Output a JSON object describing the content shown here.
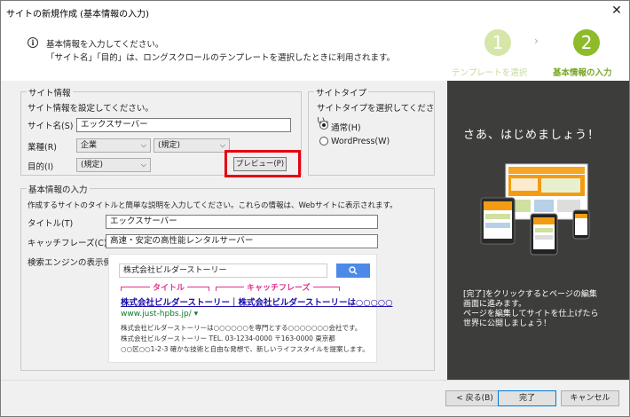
{
  "window": {
    "title": "サイトの新規作成 (基本情報の入力)",
    "close": "✕"
  },
  "header": {
    "info_line1": "基本情報を入力してください。",
    "info_line2": "「サイト名」「目的」は、ロングスクロールのテンプレートを選択したときに利用されます。",
    "steps": [
      {
        "number": "1",
        "label": "テンプレートを選択"
      },
      {
        "number": "2",
        "label": "基本情報の入力"
      }
    ],
    "arrow": "›"
  },
  "site_info": {
    "legend": "サイト情報",
    "desc": "サイト情報を設定してください。",
    "name_label": "サイト名(S)",
    "name_value": "エックスサーバー",
    "industry_label": "業種(R)",
    "industry_value": "企業",
    "industry_sub_value": "(規定)",
    "purpose_label": "目的(I)",
    "purpose_value": "(規定)",
    "preview_button": "プレビュー(P)"
  },
  "site_type": {
    "legend": "サイトタイプ",
    "desc": "サイトタイプを選択してください。",
    "option_normal": "通常(H)",
    "option_wordpress": "WordPress(W)",
    "selected": "通常(H)"
  },
  "basic_info": {
    "legend": "基本情報の入力",
    "desc": "作成するサイトのタイトルと簡単な説明を入力してください。これらの情報は、Webサイトに表示されます。",
    "title_label": "タイトル(T)",
    "title_value": "エックスサーバー",
    "catch_label": "キャッチフレーズ(C)",
    "catch_value": "高速・安定の高性能レンタルサーバー",
    "search_label": "検索エンジンの表示例:"
  },
  "search_preview": {
    "query": "株式会社ビルダーストーリー",
    "search_icon": "search-icon",
    "tag_title": "タイトル",
    "tag_catch": "キャッチフレーズ",
    "result_title": "株式会社ビルダーストーリー｜株式会社ビルダーストーリーは○○○○○",
    "result_url": "www.just-hpbs.jp/ ▾",
    "desc_line1": "株式会社ビルダーストーリーは○○○○○○を専門とする○○○○○○○会社です。",
    "desc_line2": "株式会社ビルダーストーリー TEL. 03-1234-0000 〒163-0000 東京都",
    "desc_line3": "○○区○○1-2-3 確かな技術と自由な発想で、新しいライフスタイルを提案します。"
  },
  "right_panel": {
    "heading": "さあ、はじめましょう！",
    "text_line1": "[完了]をクリックするとページの編集",
    "text_line2": "画面に進みます。",
    "text_line3": "ページを編集してサイトを仕上げたら",
    "text_line4": "世界に公開しましょう！"
  },
  "footer": {
    "back": "< 戻る(B)",
    "finish": "完了",
    "cancel": "キャンセル"
  },
  "colors": {
    "accent_green": "#8dbb2a",
    "light_green": "#d6e6a8",
    "highlight_red": "#e60012",
    "panel_dark": "#3d3d3b",
    "tag_pink": "#e0338b"
  }
}
